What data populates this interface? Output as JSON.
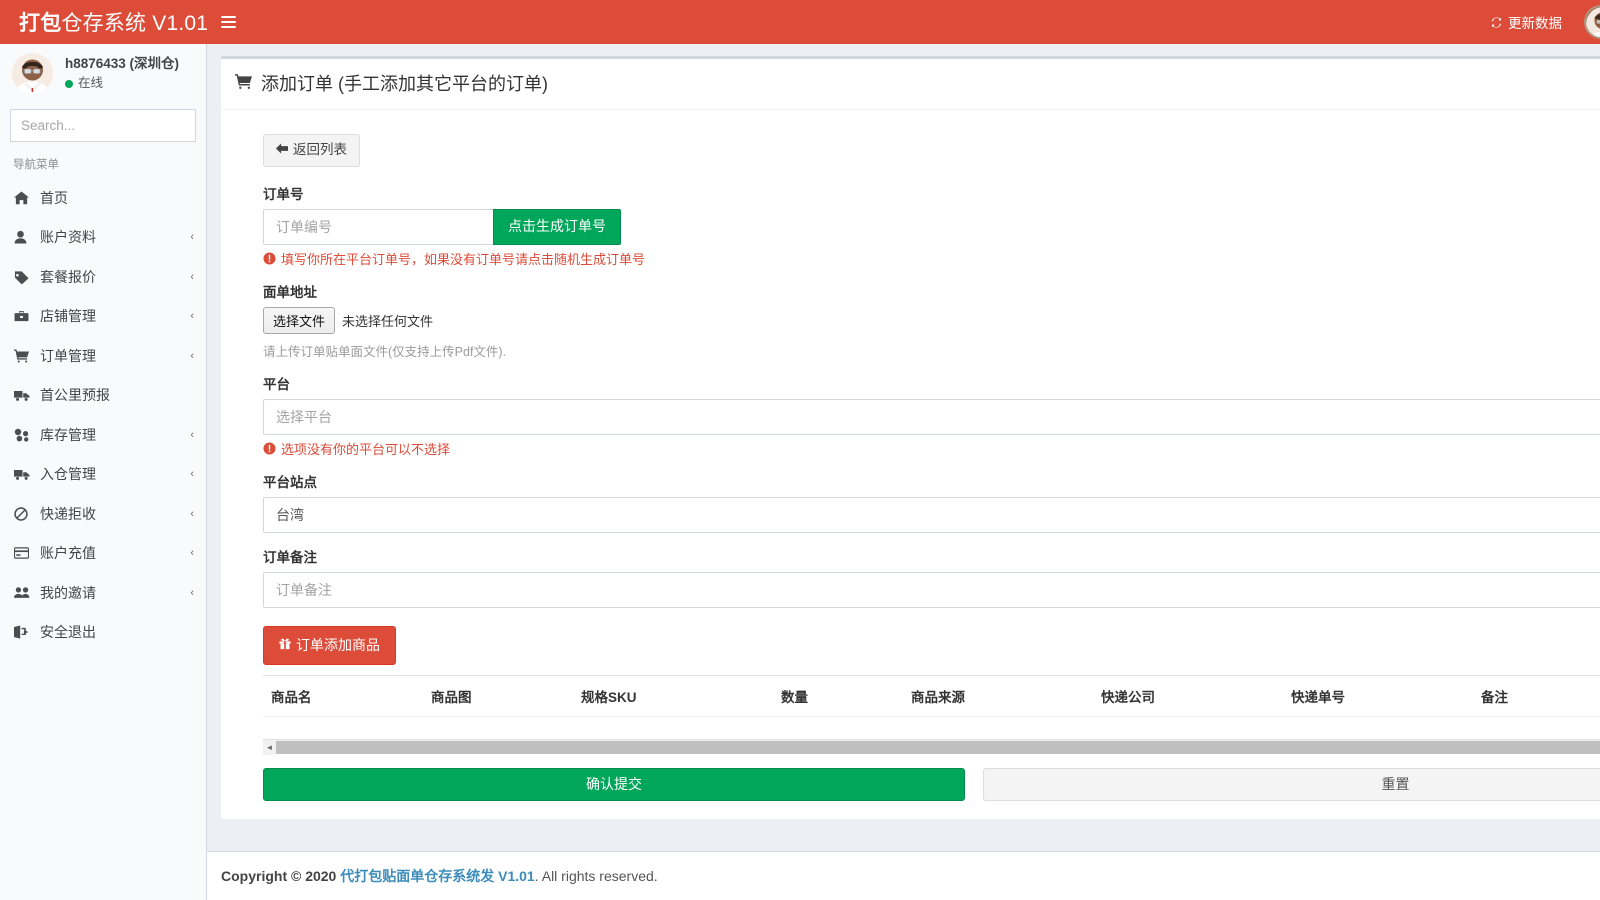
{
  "header": {
    "brand_bold": "打包",
    "brand_light": "仓存系统 V1.01",
    "menu_toggle_icon": "hamburger-icon",
    "refresh_label": "更新数据",
    "refresh_icon": "refresh-icon",
    "avatar_icon": "user-avatar"
  },
  "sidebar": {
    "user": {
      "name": "h8876433 (深圳仓)",
      "status": "在线"
    },
    "search": {
      "placeholder": "Search...",
      "value": "",
      "icon": "search-icon"
    },
    "section_header": "导航菜单",
    "items": [
      {
        "label": "首页",
        "icon": "home-icon",
        "arrow": ""
      },
      {
        "label": "账户资料",
        "icon": "user-icon",
        "arrow": "‹"
      },
      {
        "label": "套餐报价",
        "icon": "tag-icon",
        "arrow": "‹"
      },
      {
        "label": "店铺管理",
        "icon": "briefcase-icon",
        "arrow": "‹"
      },
      {
        "label": "订单管理",
        "icon": "cart-icon",
        "arrow": "‹"
      },
      {
        "label": "首公里预报",
        "icon": "truck-icon",
        "arrow": ""
      },
      {
        "label": "库存管理",
        "icon": "boxes-icon",
        "arrow": "‹"
      },
      {
        "label": "入仓管理",
        "icon": "truck-icon",
        "arrow": "‹"
      },
      {
        "label": "快递拒收",
        "icon": "ban-icon",
        "arrow": "‹"
      },
      {
        "label": "账户充值",
        "icon": "credit-card-icon",
        "arrow": "‹"
      },
      {
        "label": "我的邀请",
        "icon": "users-icon",
        "arrow": "‹"
      },
      {
        "label": "安全退出",
        "icon": "logout-icon",
        "arrow": ""
      }
    ]
  },
  "main": {
    "box_title": "添加订单 (手工添加其它平台的订单)",
    "box_title_icon": "cart-icon",
    "back_button": "返回列表",
    "back_icon": "arrow-left-icon",
    "fields": {
      "order_no": {
        "label": "订单号",
        "placeholder": "订单编号",
        "value": "",
        "generate_button": "点击生成订单号",
        "help": "填写你所在平台订单号，如果没有订单号请点击随机生成订单号"
      },
      "label_file": {
        "label": "面单地址",
        "choose_button": "选择文件",
        "file_status": "未选择任何文件",
        "help": "请上传订单贴单面文件(仅支持上传Pdf文件)."
      },
      "platform": {
        "label": "平台",
        "placeholder": "选择平台",
        "value": "",
        "help": "选项没有你的平台可以不选择"
      },
      "platform_site": {
        "label": "平台站点",
        "value": "台湾"
      },
      "order_remark": {
        "label": "订单备注",
        "placeholder": "订单备注",
        "value": ""
      }
    },
    "add_goods_button": "订单添加商品",
    "add_goods_icon": "gift-icon",
    "goods_table": {
      "columns": [
        "商品名",
        "商品图",
        "规格SKU",
        "数量",
        "商品来源",
        "快递公司",
        "快递单号",
        "备注"
      ],
      "rows": []
    },
    "submit_button": "确认提交",
    "reset_button": "重置"
  },
  "footer": {
    "copyright_prefix": "Copyright © 2020",
    "link": "代打包贴面单仓存系统发 V1.01",
    "suffix": ". All rights reserved."
  },
  "colors": {
    "brand_red": "#dd4b39",
    "green": "#00a65a",
    "link_blue": "#3c8dbc",
    "content_bg": "#ecf0f5",
    "sidebar_bg": "#f9fafc"
  }
}
